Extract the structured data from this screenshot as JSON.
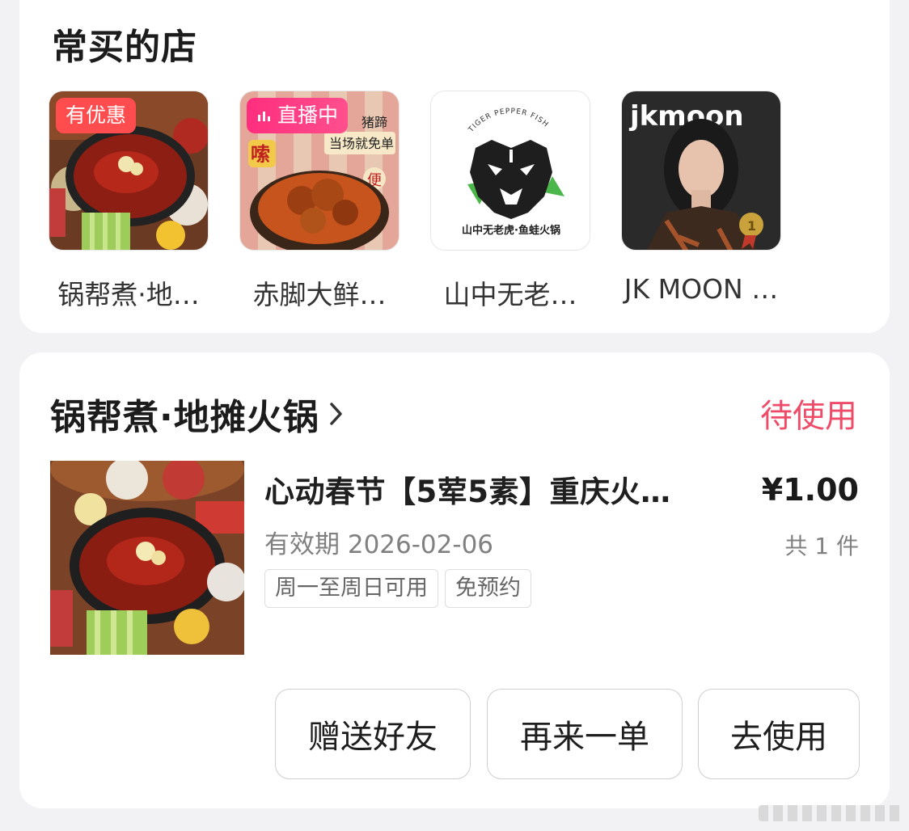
{
  "frequent_stores": {
    "title": "常买的店",
    "stores": [
      {
        "name": "锅帮煮·地…",
        "badge": "有优惠"
      },
      {
        "name": "赤脚大鲜…",
        "badge": "直播中",
        "thumb_text": [
          "嗦",
          "猪蹄",
          "当场就免单",
          "便"
        ]
      },
      {
        "name": "山中无老…",
        "thumb_text": [
          "TIGER PEPPER FISH",
          "山中无老虎·鱼蛙火锅"
        ]
      },
      {
        "name": "JK MOON …",
        "thumb_text": [
          "jkmoon",
          "1"
        ]
      }
    ]
  },
  "order": {
    "shop_name": "锅帮煮·地摊火锅",
    "status": "待使用",
    "product_title": "心动春节【5荤5素】重庆火…",
    "price": "¥1.00",
    "expiry": "有效期 2026-02-06",
    "quantity": "共 1 件",
    "tags": [
      "周一至周日可用",
      "免预约"
    ],
    "buttons": {
      "gift": "赠送好友",
      "reorder": "再来一单",
      "use": "去使用"
    }
  },
  "colors": {
    "accent": "#ef4c6a",
    "deal_badge": "#ff4d4f",
    "live_badge": "#ff2e7e"
  }
}
